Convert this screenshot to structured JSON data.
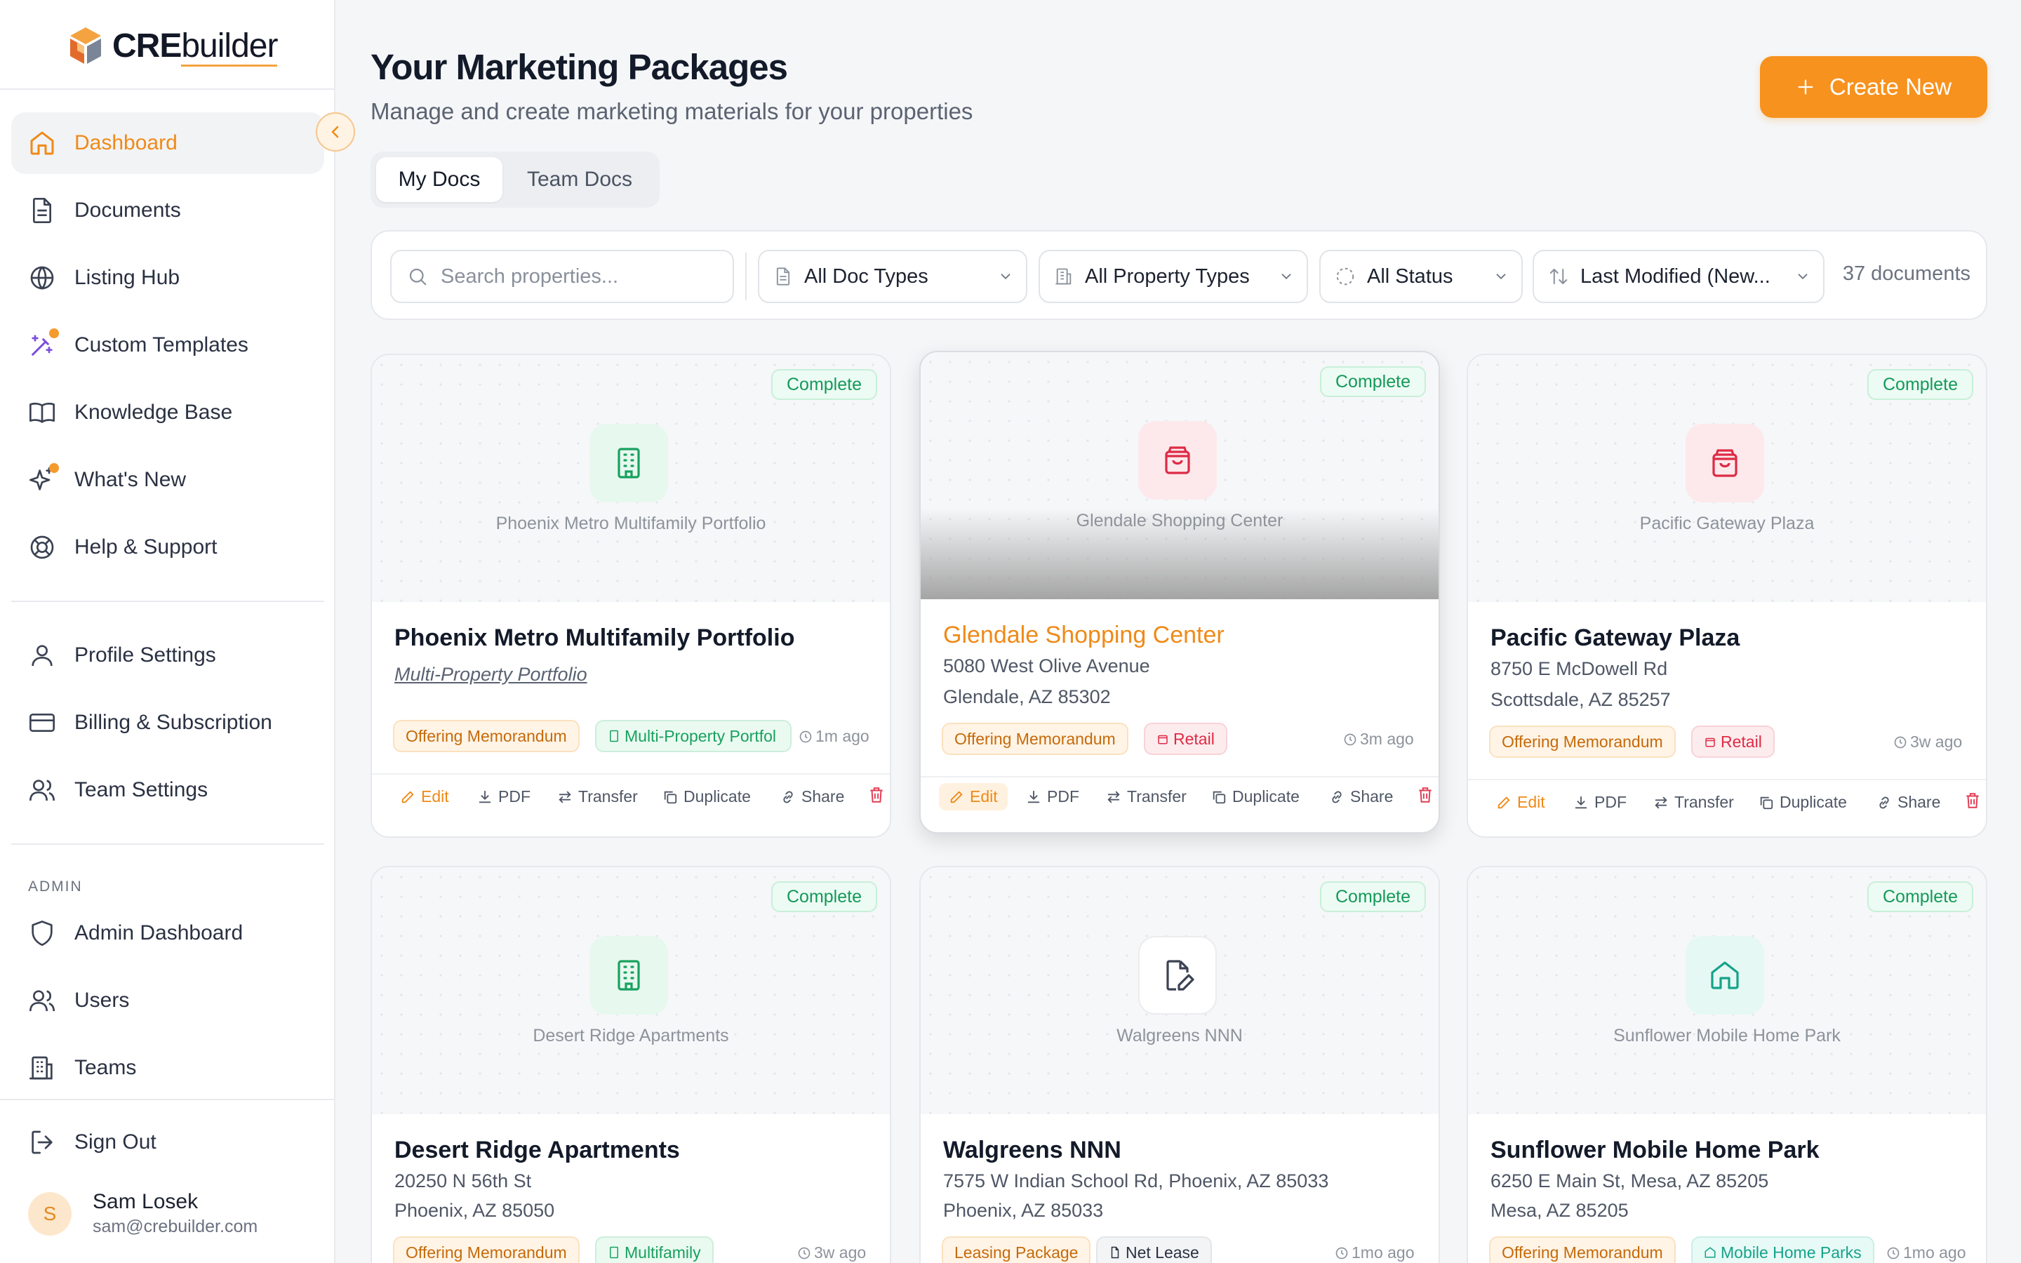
{
  "app": {
    "logo_bold": "CRE",
    "logo_rest": "builder"
  },
  "sidebar": {
    "main_items": [
      {
        "label": "Dashboard",
        "icon": "home-icon",
        "active": true
      },
      {
        "label": "Documents",
        "icon": "document-icon"
      },
      {
        "label": "Listing Hub",
        "icon": "globe-icon"
      },
      {
        "label": "Custom Templates",
        "icon": "magic-wand-icon",
        "badge_dot": true
      },
      {
        "label": "Knowledge Base",
        "icon": "book-icon"
      },
      {
        "label": "What's New",
        "icon": "sparkles-icon",
        "badge_dot": true
      },
      {
        "label": "Help & Support",
        "icon": "lifebuoy-icon"
      }
    ],
    "settings_items": [
      {
        "label": "Profile Settings",
        "icon": "user-icon"
      },
      {
        "label": "Billing & Subscription",
        "icon": "credit-card-icon"
      },
      {
        "label": "Team Settings",
        "icon": "users-icon"
      }
    ],
    "admin_label": "ADMIN",
    "admin_items": [
      {
        "label": "Admin Dashboard",
        "icon": "shield-icon"
      },
      {
        "label": "Users",
        "icon": "users-icon"
      },
      {
        "label": "Teams",
        "icon": "building-icon"
      }
    ],
    "sign_out": "Sign Out",
    "user": {
      "initial": "S",
      "name": "Sam Losek",
      "email": "sam@crebuilder.com"
    }
  },
  "header": {
    "title": "Your Marketing Packages",
    "subtitle": "Manage and create marketing materials for your properties",
    "create_button": "Create New"
  },
  "tabs": [
    {
      "label": "My Docs",
      "active": true
    },
    {
      "label": "Team Docs"
    }
  ],
  "filters": {
    "search_placeholder": "Search properties...",
    "doc_types": "All Doc Types",
    "property_types": "All Property Types",
    "status": "All Status",
    "sort": "Last Modified (New...",
    "count": "37 documents"
  },
  "actions": {
    "edit": "Edit",
    "pdf": "PDF",
    "transfer": "Transfer",
    "duplicate": "Duplicate",
    "share": "Share"
  },
  "cards": [
    {
      "status": "Complete",
      "thumb_label": "Phoenix Metro Multifamily Portfolio",
      "title": "Phoenix Metro Multifamily Portfolio",
      "subtitle": "Multi-Property Portfolio",
      "doc_type": "Offering Memorandum",
      "property_type": "Multi-Property Portfol",
      "time": "1m ago",
      "icon": "building-icon",
      "accent": "#19a15f"
    },
    {
      "status": "Complete",
      "thumb_label": "Glendale Shopping Center",
      "title": "Glendale Shopping Center",
      "address1": "5080 West Olive Avenue",
      "address2": "Glendale, AZ 85302",
      "doc_type": "Offering Memorandum",
      "property_type": "Retail",
      "time": "3m ago",
      "icon": "shopping-bag-icon",
      "accent": "#de2b45"
    },
    {
      "status": "Complete",
      "thumb_label": "Pacific Gateway Plaza",
      "title": "Pacific Gateway Plaza",
      "address1": "8750 E McDowell Rd",
      "address2": "Scottsdale, AZ 85257",
      "doc_type": "Offering Memorandum",
      "property_type": "Retail",
      "time": "3w ago",
      "icon": "shopping-bag-icon",
      "accent": "#de2b45"
    },
    {
      "status": "Complete",
      "thumb_label": "Desert Ridge Apartments",
      "title": "Desert Ridge Apartments",
      "address1": "20250 N 56th St",
      "address2": "Phoenix, AZ 85050",
      "doc_type": "Offering Memorandum",
      "property_type": "Multifamily",
      "time": "3w ago",
      "icon": "building-icon",
      "accent": "#19a15f"
    },
    {
      "status": "Complete",
      "thumb_label": "Walgreens NNN",
      "title": "Walgreens NNN",
      "address1": "7575 W Indian School Rd, Phoenix, AZ 85033",
      "address2": "Phoenix, AZ 85033",
      "doc_type": "Leasing Package",
      "property_type": "Net Lease",
      "time": "1mo ago",
      "icon": "file-edit-icon",
      "accent": "#3b4252"
    },
    {
      "status": "Complete",
      "thumb_label": "Sunflower Mobile Home Park",
      "title": "Sunflower Mobile Home Park",
      "address1": "6250 E Main St, Mesa, AZ 85205",
      "address2": "Mesa, AZ 85205",
      "doc_type": "Offering Memorandum",
      "property_type": "Mobile Home Parks",
      "time": "1mo ago",
      "icon": "home-icon",
      "accent": "#15a38a"
    }
  ]
}
